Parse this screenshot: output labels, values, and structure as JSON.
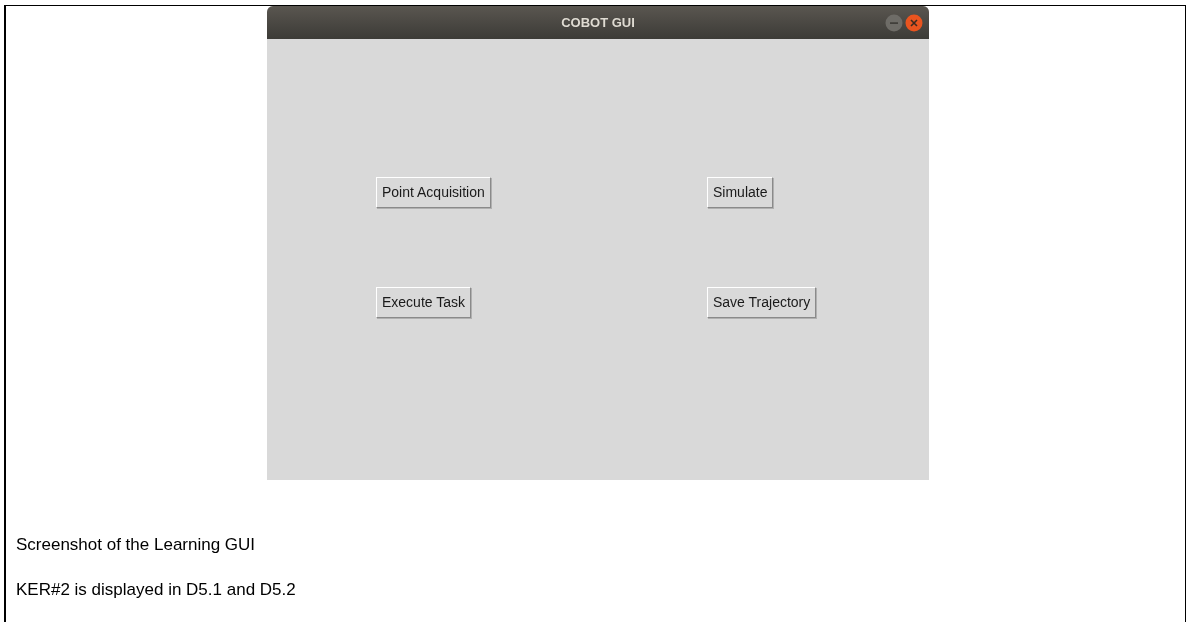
{
  "window": {
    "title": "COBOT GUI"
  },
  "buttons": [
    "Point Acquisition",
    "Simulate",
    "Execute Task",
    "Save Trajectory"
  ],
  "captions": [
    "Screenshot of the Learning GUI",
    "KER#2 is displayed in D5.1 and D5.2"
  ]
}
